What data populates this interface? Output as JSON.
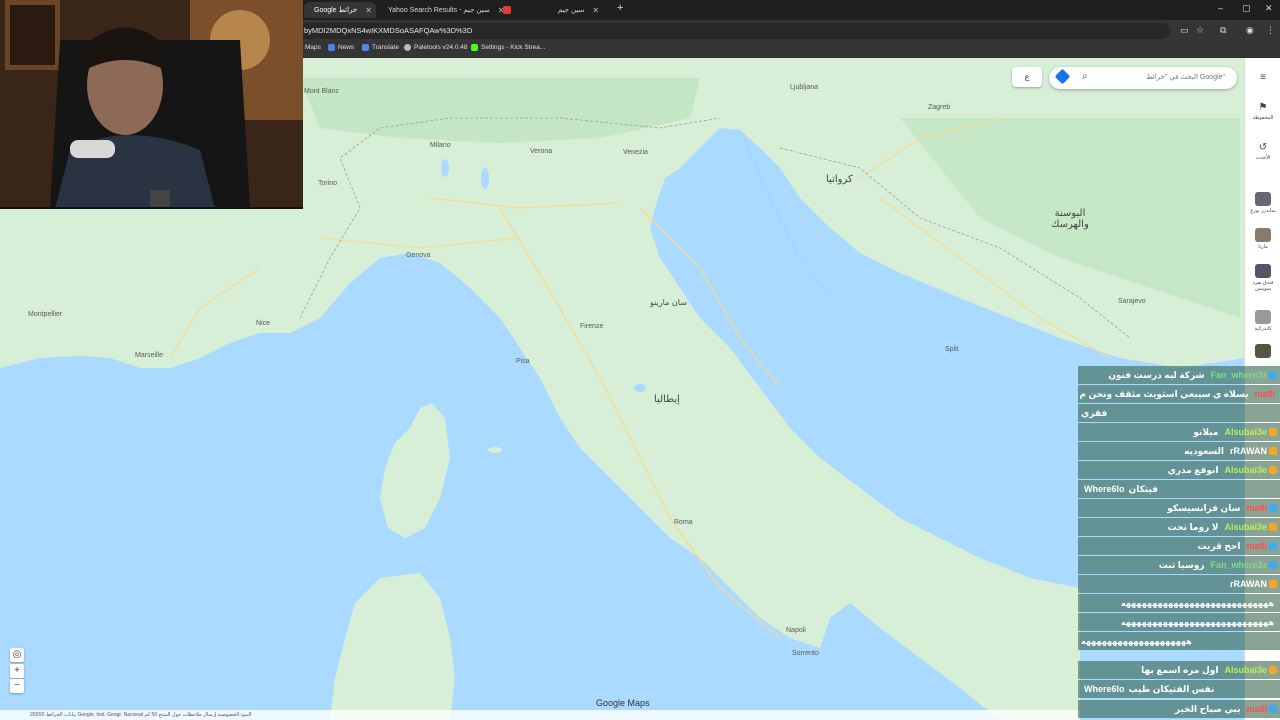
{
  "browser": {
    "tabs": [
      {
        "label": "Google خرائط",
        "active": true
      },
      {
        "label": "Yahoo Search Results - سين جيم",
        "active": false
      },
      {
        "label": "",
        "active": false
      },
      {
        "label": "سين جيم",
        "active": false
      }
    ],
    "new_tab": "+",
    "url": "byMDI2MDQxNS4wIKXMDSoASAFQAw%3D%3D",
    "bookmarks": [
      "Maps",
      "News",
      "Translate",
      "Paletools v24.0.48",
      "Settings - Kick Strea..."
    ],
    "window_controls": [
      "–",
      "▢",
      "✕"
    ]
  },
  "map": {
    "search_placeholder": "البحث في \"خرائط Google\"",
    "layers_label": "ع",
    "countries": [
      "إيطاليا",
      "كرواتيا",
      "البوسنة والهرسك",
      "سان مارينو"
    ],
    "cities": [
      "Mont Blanc",
      "Milano",
      "Verona",
      "Venezia",
      "Torino",
      "Genova",
      "Firenze",
      "Pisa",
      "Roma",
      "Napoli",
      "Nice",
      "Marseille",
      "Montpellier",
      "Ljubljana",
      "Zagreb",
      "Sarajevo",
      "Split",
      "Sorrento"
    ],
    "footer_text": "بيانات الخرائط ©2026 Google, Inst. Geogr. Nacional   البنود   الخصوصية   إرسال ملاحظات حول المنتج   50 كم",
    "brand": "Google Maps"
  },
  "sidebar": {
    "items": [
      {
        "icon": "menu-icon",
        "label": ""
      },
      {
        "icon": "bookmark-icon",
        "label": "المحفوظة"
      },
      {
        "icon": "history-icon",
        "label": "الأحدث"
      },
      {
        "icon": "place-thumb",
        "label": "ساندرز بورغ"
      },
      {
        "icon": "place-thumb",
        "label": "مارتا"
      },
      {
        "icon": "place-thumb",
        "label": "فندق نفرد سوينس"
      },
      {
        "icon": "place-thumb",
        "label": "كاتدرائية"
      },
      {
        "icon": "place-thumb",
        "label": ""
      }
    ]
  },
  "chat": [
    {
      "user": "Fan_where3z",
      "text": "شركة ليه درست فنون",
      "color": "#7cdc8c"
    },
    {
      "user": "ma8i",
      "text": "يسلاه ي سيبعي اسثويث مثقف ونحن م",
      "color": "#ff4b55"
    },
    {
      "user": "",
      "text": "فقري",
      "color": "#ffffff"
    },
    {
      "user": "Alsubai3e",
      "text": "ميلانو",
      "color": "#b7f05a"
    },
    {
      "user": "rRAWAN",
      "text": "السعوديه",
      "color": "#ffffff"
    },
    {
      "user": "Alsubai3e",
      "text": "انوقع مدري",
      "color": "#b7f05a"
    },
    {
      "user": "Where6lo",
      "text": "فيتكان",
      "color": "#ffffff"
    },
    {
      "user": "ma8i",
      "text": "سان فرانسيسكو",
      "color": "#ff4b55"
    },
    {
      "user": "Alsubai3e",
      "text": "لا روما تحت",
      "color": "#b7f05a"
    },
    {
      "user": "ma8i",
      "text": "احح قربت",
      "color": "#ff4b55"
    },
    {
      "user": "Fan_where3z",
      "text": "روسيا ثبت",
      "color": "#7cdc8c"
    },
    {
      "user": "rRAWAN",
      "text": "",
      "color": "#ffffff"
    },
    {
      "user": "",
      "text": "ههههههههههههههههههههههههههههه",
      "color": "#ffffff"
    },
    {
      "user": "",
      "text": "ههههههههههههههههههههههههههههه",
      "color": "#ffffff"
    },
    {
      "user": "",
      "text": "ههههههههههههههههههههه",
      "color": "#ffffff"
    },
    {
      "user": "Alsubai3e",
      "text": "اول مره اسمع بها",
      "color": "#b7f05a"
    },
    {
      "user": "Where6lo",
      "text": "نفس الفتيكان طيب",
      "color": "#ffffff"
    },
    {
      "user": "ma8i",
      "text": "يبي صباح الخير",
      "color": "#ff4b55"
    }
  ]
}
